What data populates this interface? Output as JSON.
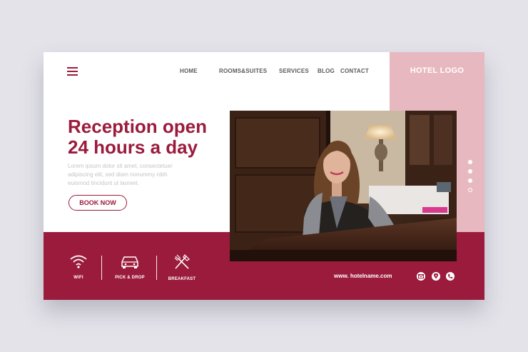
{
  "nav": {
    "home": "HOME",
    "rooms": "ROOMS&SUITES",
    "services": "SERVICES",
    "blog": "BLOG",
    "contact": "CONTACT"
  },
  "brand": {
    "logo": "HOTEL LOGO"
  },
  "hero": {
    "line1": "Reception open",
    "line2": "24 hours a day",
    "body_lines": [
      "Lorem ipsum dolor sit amet, consectetuer",
      "adipiscing elit, sed diam nonummy nibh",
      "euismod tincidunt ut laoreet."
    ],
    "cta": "BOOK NOW"
  },
  "slider": {
    "dots": 4,
    "active_index": 3
  },
  "features": [
    {
      "label": "WIFI",
      "icon": "wifi-icon"
    },
    {
      "label": "PICK & DROP",
      "icon": "car-icon"
    },
    {
      "label": "BREAKFAST",
      "icon": "fork-knife-icon"
    }
  ],
  "footer": {
    "url": "www. hotelname.com",
    "icons": [
      "mail-icon",
      "location-icon",
      "phone-icon"
    ]
  },
  "colors": {
    "primary": "#9b1b3c",
    "pink": "#e8b8c0",
    "background": "#e4e3ea"
  }
}
